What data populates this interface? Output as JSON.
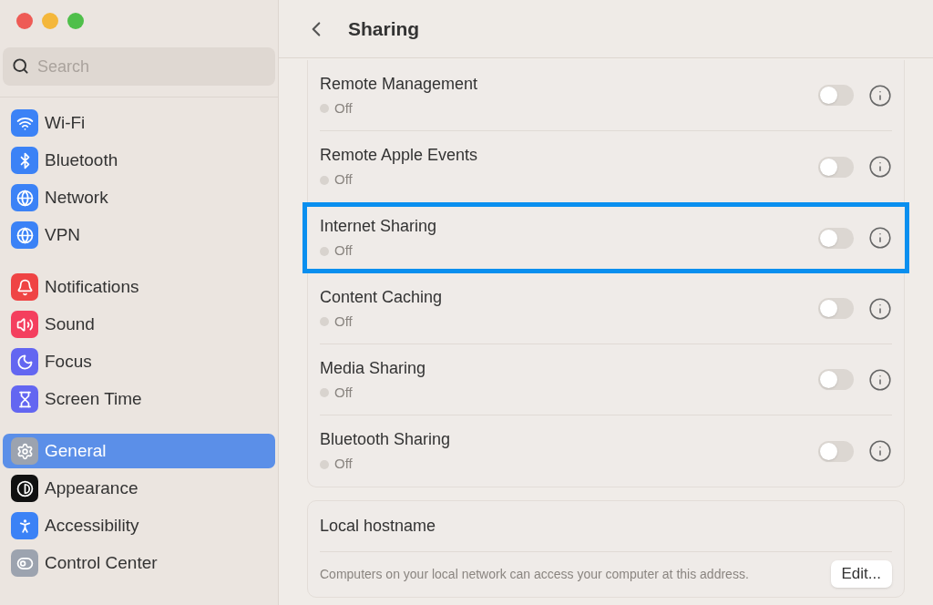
{
  "window": {
    "title": "Sharing"
  },
  "sidebar": {
    "search": {
      "placeholder": "Search"
    },
    "groups": [
      [
        {
          "kind": "wifi",
          "label": "Wi-Fi",
          "selected": false
        },
        {
          "kind": "bluetooth",
          "label": "Bluetooth",
          "selected": false
        },
        {
          "kind": "network",
          "label": "Network",
          "selected": false
        },
        {
          "kind": "vpn",
          "label": "VPN",
          "selected": false
        }
      ],
      [
        {
          "kind": "notifications",
          "label": "Notifications",
          "selected": false
        },
        {
          "kind": "sound",
          "label": "Sound",
          "selected": false
        },
        {
          "kind": "focus",
          "label": "Focus",
          "selected": false
        },
        {
          "kind": "screentime",
          "label": "Screen Time",
          "selected": false
        }
      ],
      [
        {
          "kind": "general",
          "label": "General",
          "selected": true
        },
        {
          "kind": "appearance",
          "label": "Appearance",
          "selected": false
        },
        {
          "kind": "accessibility",
          "label": "Accessibility",
          "selected": false
        },
        {
          "kind": "controlcenter",
          "label": "Control Center",
          "selected": false
        }
      ]
    ]
  },
  "services": [
    {
      "name": "Remote Management",
      "status": "Off",
      "on": false,
      "highlighted": false
    },
    {
      "name": "Remote Apple Events",
      "status": "Off",
      "on": false,
      "highlighted": false
    },
    {
      "name": "Internet Sharing",
      "status": "Off",
      "on": false,
      "highlighted": true
    },
    {
      "name": "Content Caching",
      "status": "Off",
      "on": false,
      "highlighted": false
    },
    {
      "name": "Media Sharing",
      "status": "Off",
      "on": false,
      "highlighted": false
    },
    {
      "name": "Bluetooth Sharing",
      "status": "Off",
      "on": false,
      "highlighted": false
    }
  ],
  "hostname": {
    "title": "Local hostname",
    "description": "Computers on your local network can access your computer at this address.",
    "button": "Edit..."
  }
}
